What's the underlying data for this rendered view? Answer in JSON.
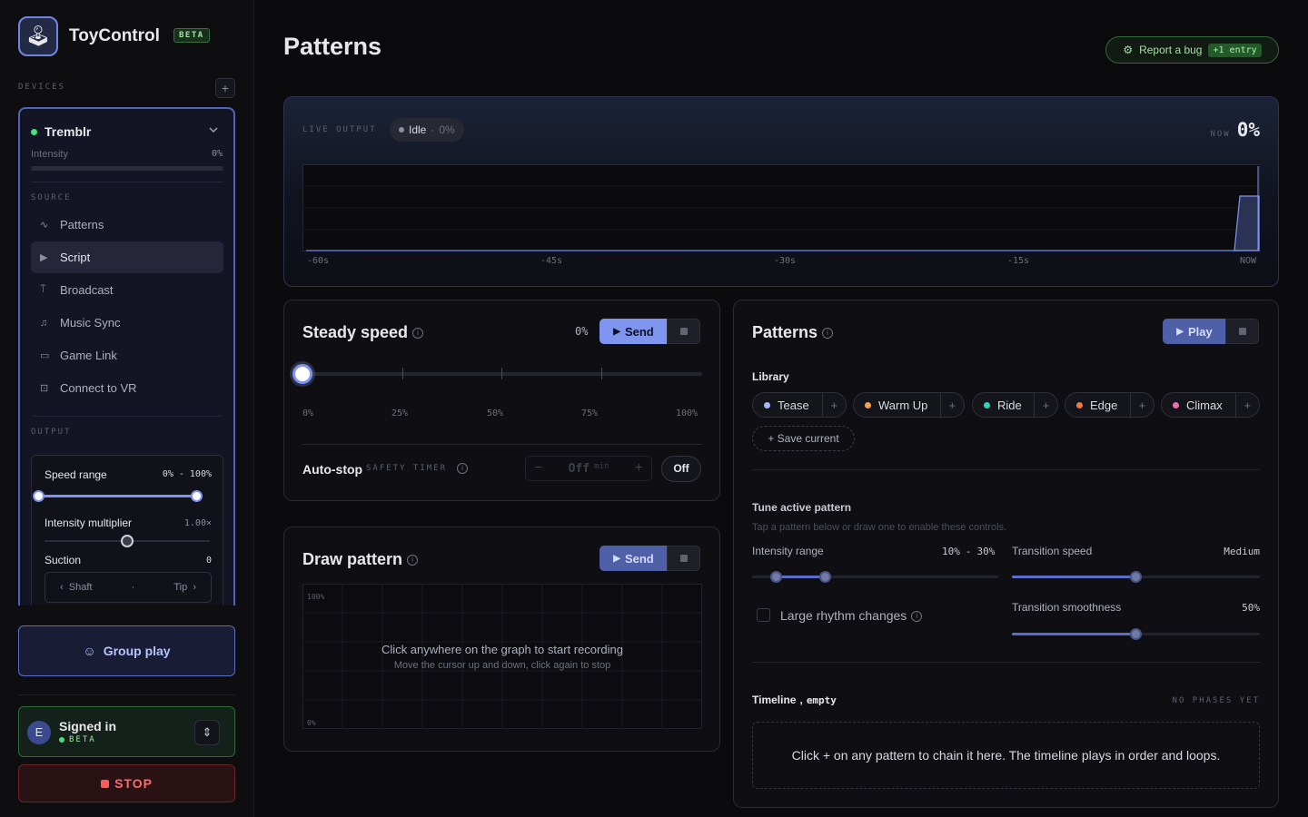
{
  "app": {
    "name": "ToyControl",
    "beta_tag": "BETA",
    "logo_glyph": "🕹"
  },
  "sidebar": {
    "devices_label": "DEVICES",
    "add_device_glyph": "+",
    "device": {
      "name": "Tremblr",
      "status_color": "#4ade80",
      "intensity_label": "Intensity",
      "intensity_value": "0%",
      "intensity_level": 0
    },
    "source_label": "SOURCE",
    "sources": [
      {
        "label": "Patterns",
        "icon": "wave-icon",
        "glyph": "∿"
      },
      {
        "label": "Script",
        "icon": "play-icon",
        "glyph": "▶",
        "selected": true
      },
      {
        "label": "Broadcast",
        "icon": "broadcast-icon",
        "glyph": "⍑"
      },
      {
        "label": "Music Sync",
        "icon": "music-icon",
        "glyph": "♫"
      },
      {
        "label": "Game Link",
        "icon": "gamepad-icon",
        "glyph": "▭"
      },
      {
        "label": "Connect to VR",
        "icon": "vr-headset-icon",
        "glyph": "⊡"
      }
    ],
    "output_label": "OUTPUT",
    "output": {
      "speed_range_label": "Speed range",
      "speed_min": "0%",
      "speed_sep": "-",
      "speed_max": "100%",
      "speed_low": 0,
      "speed_high": 1,
      "intensity_multiplier_label": "Intensity multiplier",
      "intensity_multiplier_value": "1.00×",
      "intensity_multiplier_level": 0.5,
      "suction_label": "Suction",
      "suction_value": "0",
      "shaft_label": "Shaft",
      "tip_label": "Tip",
      "mid_glyph": "·",
      "left_chevron": "‹",
      "right_chevron": "›"
    },
    "group_play_label": "Group play",
    "group_icon": "☺",
    "user": {
      "avatar_letter": "E",
      "signed_label": "Signed in",
      "beta_label": "BETA",
      "toggle_glyph": "⇕"
    },
    "stop_label": "STOP"
  },
  "header": {
    "title": "Patterns",
    "bug_label": "Report a bug",
    "bug_count": "+1 entry",
    "bug_icon": "⚙"
  },
  "live": {
    "label": "LIVE OUTPUT",
    "status": "Idle",
    "status_sep": "·",
    "status_value": "0%",
    "now_label": "NOW",
    "now_value": "0%",
    "ticks": [
      "-60s",
      "-45s",
      "-30s",
      "-15s",
      "NOW"
    ]
  },
  "steady": {
    "title": "Steady speed",
    "value": "0%",
    "send_label": "Send",
    "play_glyph": "▶",
    "speed_level": 0,
    "ticks": [
      "0%",
      "25%",
      "50%",
      "75%",
      "100%"
    ],
    "autostop_label": "Auto-stop",
    "safety_label": "SAFETY TIMER",
    "minus": "−",
    "timer_value": "Off",
    "timer_unit": "min",
    "plus": "+",
    "off_button": "Off"
  },
  "draw": {
    "title": "Draw pattern",
    "send_label": "Send",
    "top_label": "100%",
    "bottom_label": "0%",
    "hint_main": "Click anywhere on the graph to start recording",
    "hint_sub": "Move the cursor up and down, click again to stop"
  },
  "patterns": {
    "title": "Patterns",
    "play_label": "Play",
    "library_label": "Library",
    "library": [
      {
        "name": "Tease",
        "color": "#a9b6ff"
      },
      {
        "name": "Warm Up",
        "color": "#f5a04a"
      },
      {
        "name": "Ride",
        "color": "#2dd4bf"
      },
      {
        "name": "Edge",
        "color": "#f2784b"
      },
      {
        "name": "Climax",
        "color": "#f06ab0"
      }
    ],
    "add_glyph": "+",
    "save_current": "+ Save current",
    "tune_title": "Tune active pattern",
    "tune_hint": "Tap a pattern below or draw one to enable these controls.",
    "intensity_range_label": "Intensity range",
    "intensity_min": "10%",
    "intensity_sep": "-",
    "intensity_max": "30%",
    "intensity_low": 0.1,
    "intensity_high": 0.3,
    "transition_speed_label": "Transition speed",
    "transition_speed_value": "Medium",
    "transition_speed_level": 0.5,
    "rhythm_label": "Large rhythm changes",
    "smooth_label": "Transition smoothness",
    "smooth_value": "50%",
    "smooth_level": 0.5,
    "timeline_label": "Timeline",
    "timeline_sep": ",",
    "timeline_state": "empty",
    "no_phases": "NO PHASES YET",
    "timeline_hint": "Click + on any pattern to chain it here. The timeline plays in order and loops."
  }
}
